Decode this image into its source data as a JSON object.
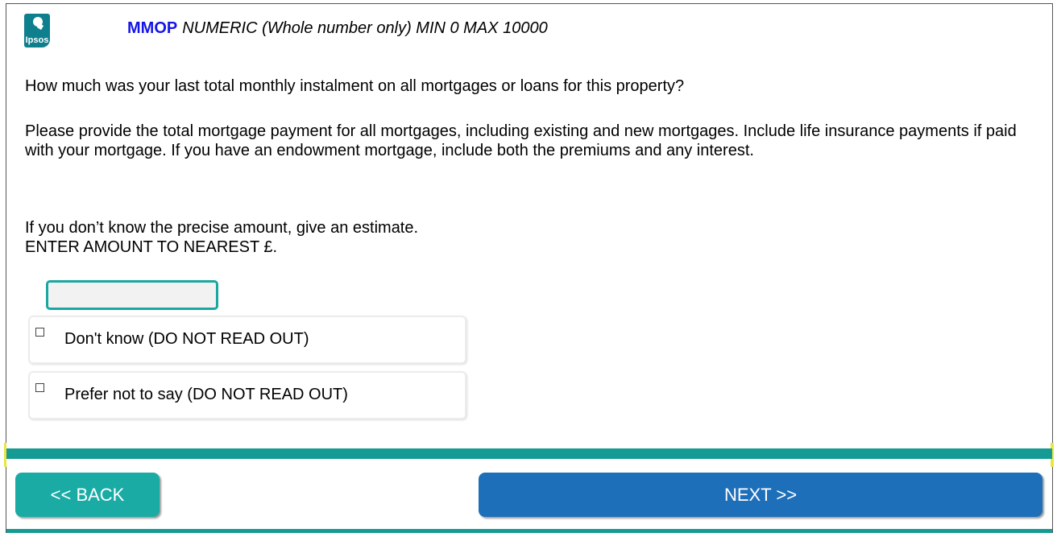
{
  "header": {
    "logo_text": "Ipsos",
    "question_id": "MMOP",
    "question_type": "NUMERIC (Whole number only) MIN 0 MAX 10000"
  },
  "question": {
    "text": "How much was your last total monthly instalment on all mortgages or loans for this property?",
    "instruction": "Please provide the total mortgage payment for all mortgages, including existing and new mortgages. Include life insurance payments if paid with your mortgage. If you have an endowment mortgage, include both the premiums and any interest.",
    "estimate_note": "If you don’t know the precise amount, give an estimate.",
    "entry_note": "ENTER AMOUNT TO NEAREST £."
  },
  "answer": {
    "value": "",
    "placeholder": ""
  },
  "options": [
    {
      "label": "Don't know (DO NOT READ OUT)",
      "checked": false
    },
    {
      "label": "Prefer not to say (DO NOT READ OUT)",
      "checked": false
    }
  ],
  "navigation": {
    "back_label": "<< BACK",
    "next_label": "NEXT >>"
  },
  "colors": {
    "accent_teal": "#1aaba5",
    "next_blue": "#1e6fba",
    "question_id_blue": "#1515e6",
    "logo_teal": "#0e7f8c"
  }
}
